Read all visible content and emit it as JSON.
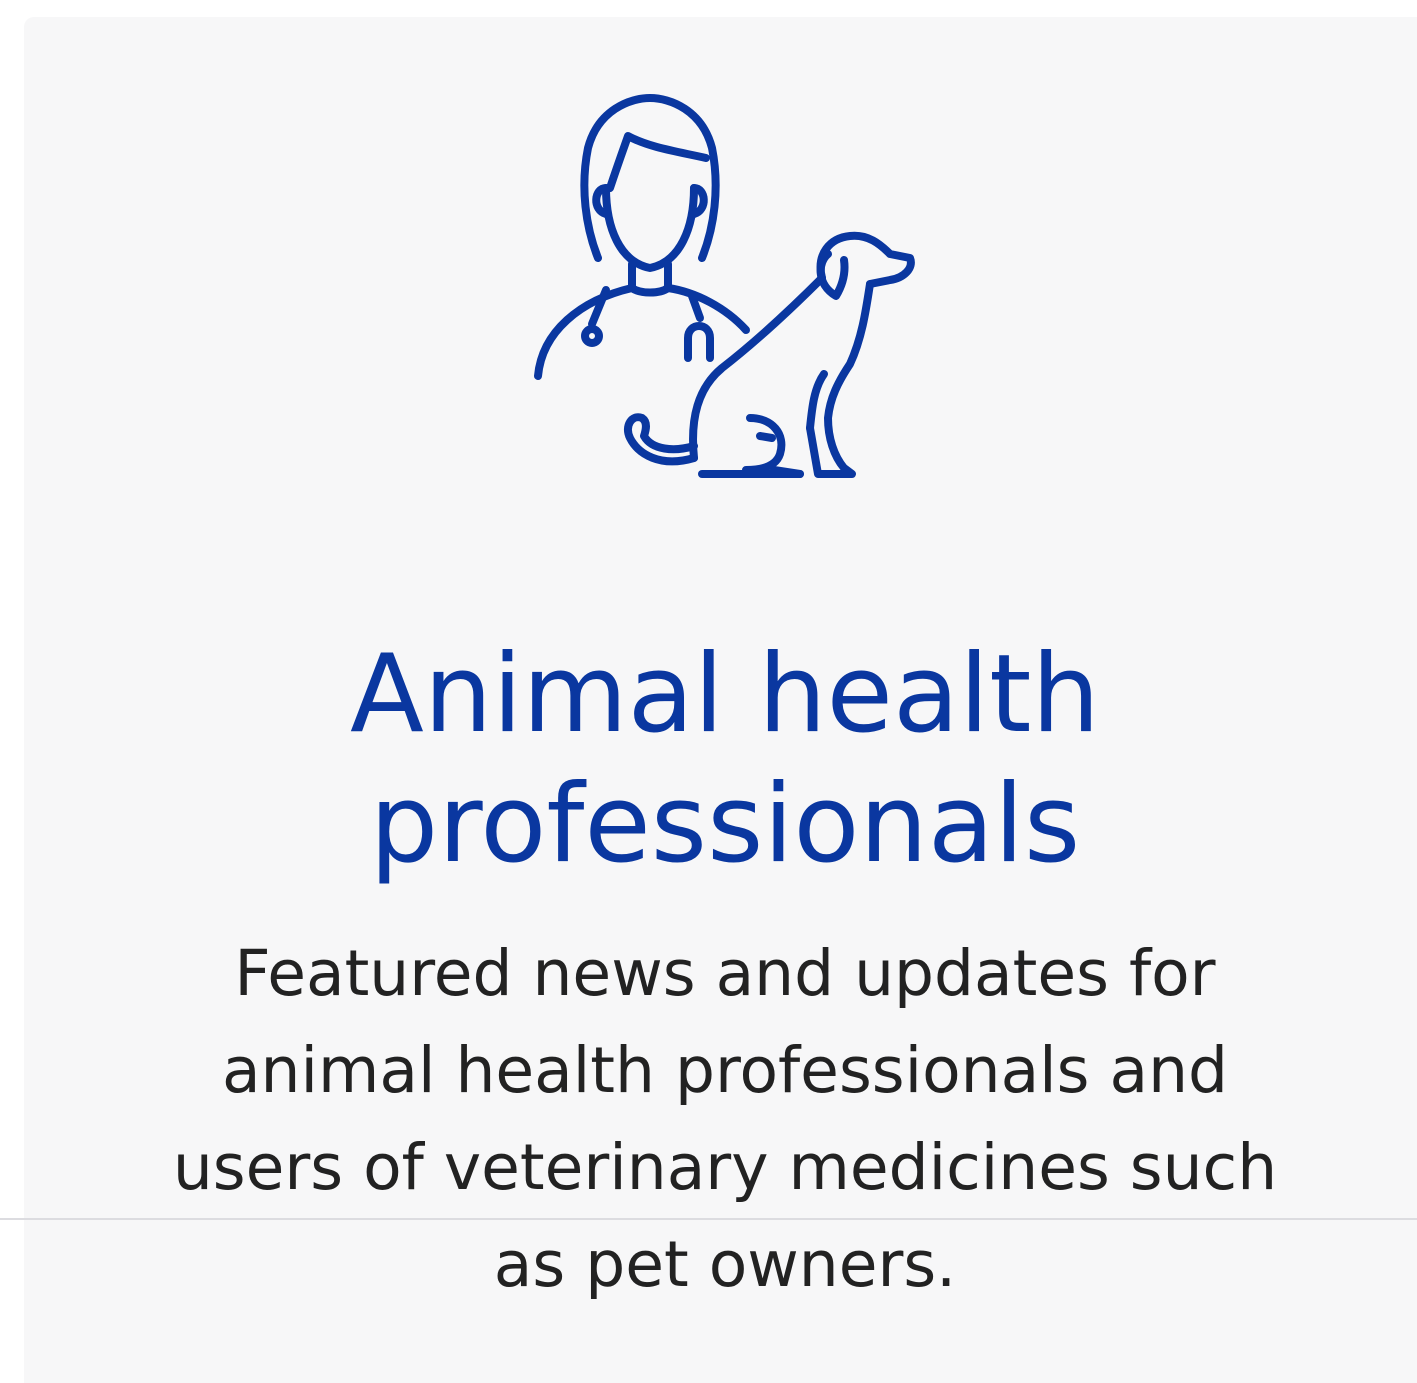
{
  "card": {
    "icon": "veterinarian-with-dog-icon",
    "title_line1": "Animal health",
    "title_line2": "professionals",
    "description_lines": [
      "Featured news and updates for",
      "animal health professionals and",
      "users of veterinary medicines such",
      "as pet owners."
    ]
  },
  "colors": {
    "accent": "#0a37a0",
    "card_background": "#f7f7f8",
    "text": "#222222",
    "divider": "#dcdce0"
  }
}
